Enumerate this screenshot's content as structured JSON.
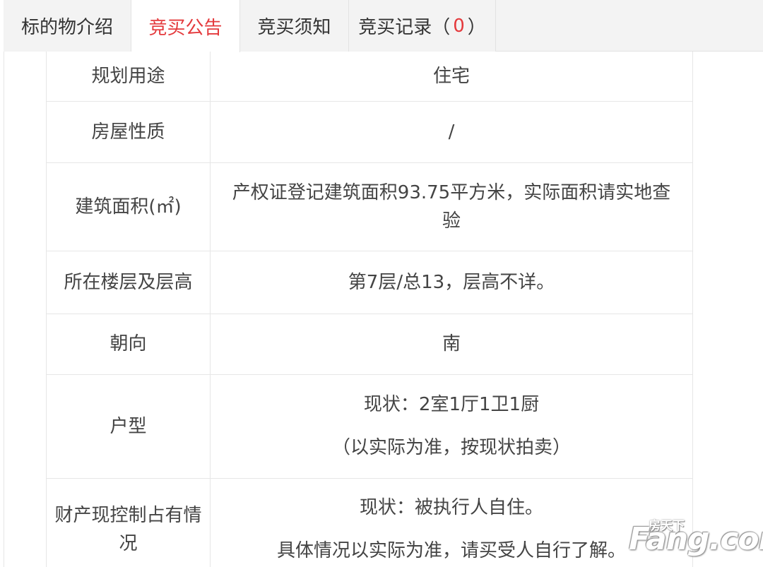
{
  "tabs": [
    {
      "label": "标的物介绍",
      "active": false
    },
    {
      "label": "竞买公告",
      "active": true
    },
    {
      "label": "竞买须知",
      "active": false
    },
    {
      "label": "竞买记录（",
      "count": "0",
      "suffix": "）",
      "active": false
    }
  ],
  "rows": [
    {
      "label": "规划用途",
      "value": [
        "住宅"
      ]
    },
    {
      "label": "房屋性质",
      "value": [
        "/"
      ]
    },
    {
      "label": "建筑面积(㎡)",
      "value": [
        "产权证登记建筑面积93.75平方米，实际面积请实地查验"
      ]
    },
    {
      "label": "所在楼层及层高",
      "value": [
        "第7层/总13，层高不详。"
      ]
    },
    {
      "label": "朝向",
      "value": [
        "南"
      ]
    },
    {
      "label": "户型",
      "value": [
        "现状：2室1厅1卫1厨",
        "（以实际为准，按现状拍卖）"
      ]
    },
    {
      "label": "财产现控制占有情况",
      "value": [
        "现状：被执行人自住。",
        "具体情况以实际为准，请买受人自行了解。"
      ]
    }
  ],
  "watermark": {
    "main": "Fang.com",
    "sub": "房天下"
  },
  "colors": {
    "accent": "#e4393c",
    "tabbar_bg": "#f3f3f3",
    "border": "#e6e6e6"
  }
}
